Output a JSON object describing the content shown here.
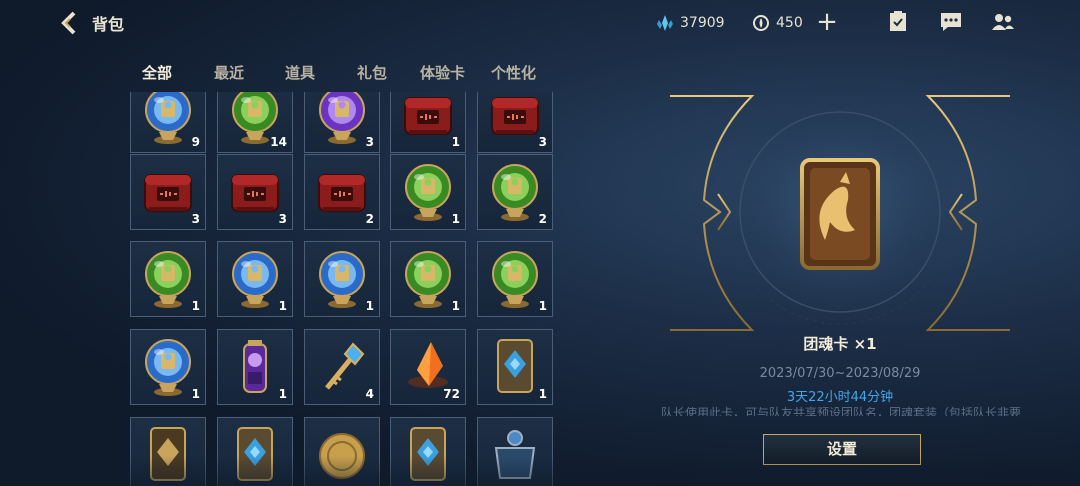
{
  "header": {
    "title": "背包",
    "currencies": [
      {
        "icon": "blue-crystal-icon",
        "value": "37909"
      },
      {
        "icon": "coin-icon",
        "value": "450"
      }
    ],
    "add_icon": "plus-icon",
    "icons": [
      "task-checklist-icon",
      "chat-icon",
      "friends-icon"
    ]
  },
  "tabs": [
    {
      "label": "全部",
      "active": true
    },
    {
      "label": "最近",
      "active": false
    },
    {
      "label": "道具",
      "active": false
    },
    {
      "label": "礼包",
      "active": false
    },
    {
      "label": "体验卡",
      "active": false
    },
    {
      "label": "个性化",
      "active": false
    }
  ],
  "inventory": {
    "rows": [
      [
        {
          "icon": "blue-orb-icon",
          "qty": "9"
        },
        {
          "icon": "green-orb-icon",
          "qty": "14"
        },
        {
          "icon": "purple-orb-icon",
          "qty": "3"
        },
        {
          "icon": "red-chest-icon",
          "qty": "1"
        },
        {
          "icon": "red-chest-icon",
          "qty": "3"
        }
      ],
      [
        {
          "icon": "red-chest-icon",
          "qty": "3"
        },
        {
          "icon": "red-chest-icon",
          "qty": "3"
        },
        {
          "icon": "red-chest-icon",
          "qty": "2"
        },
        {
          "icon": "green-orb-icon",
          "qty": "1"
        },
        {
          "icon": "green-orb-icon",
          "qty": "2"
        }
      ],
      [
        {
          "icon": "green-orb-icon",
          "qty": "1"
        },
        {
          "icon": "blue-orb-icon",
          "qty": "1"
        },
        {
          "icon": "blue-orb-icon",
          "qty": "1"
        },
        {
          "icon": "green-orb-icon",
          "qty": "1"
        },
        {
          "icon": "green-orb-icon",
          "qty": "1"
        }
      ],
      [
        {
          "icon": "blue-orb-icon",
          "qty": "1"
        },
        {
          "icon": "purple-lantern-icon",
          "qty": "1"
        },
        {
          "icon": "golden-key-icon",
          "qty": "4"
        },
        {
          "icon": "orange-crystal-icon",
          "qty": "72"
        },
        {
          "icon": "blue-emblem-card-icon",
          "qty": "1"
        }
      ],
      [
        {
          "icon": "gold-emblem-card-icon",
          "qty": ""
        },
        {
          "icon": "blue-emblem-card-icon",
          "qty": ""
        },
        {
          "icon": "gold-coin-icon",
          "qty": ""
        },
        {
          "icon": "blue-emblem-card-icon",
          "qty": ""
        },
        {
          "icon": "silver-chest-icon",
          "qty": ""
        }
      ]
    ]
  },
  "detail": {
    "item_icon": "team-soul-card-icon",
    "name": "团魂卡 ×1",
    "date_range": "2023/07/30~2023/08/29",
    "remaining": "3天22小时44分钟",
    "description": "队长使用此卡，可与队友共享预设团队名，团魂套装（包括队长非要",
    "button_label": "设置"
  },
  "colors": {
    "accent_gold": "#c8a45c",
    "remaining_blue": "#3fa8e8",
    "background": "#1b2c44"
  }
}
